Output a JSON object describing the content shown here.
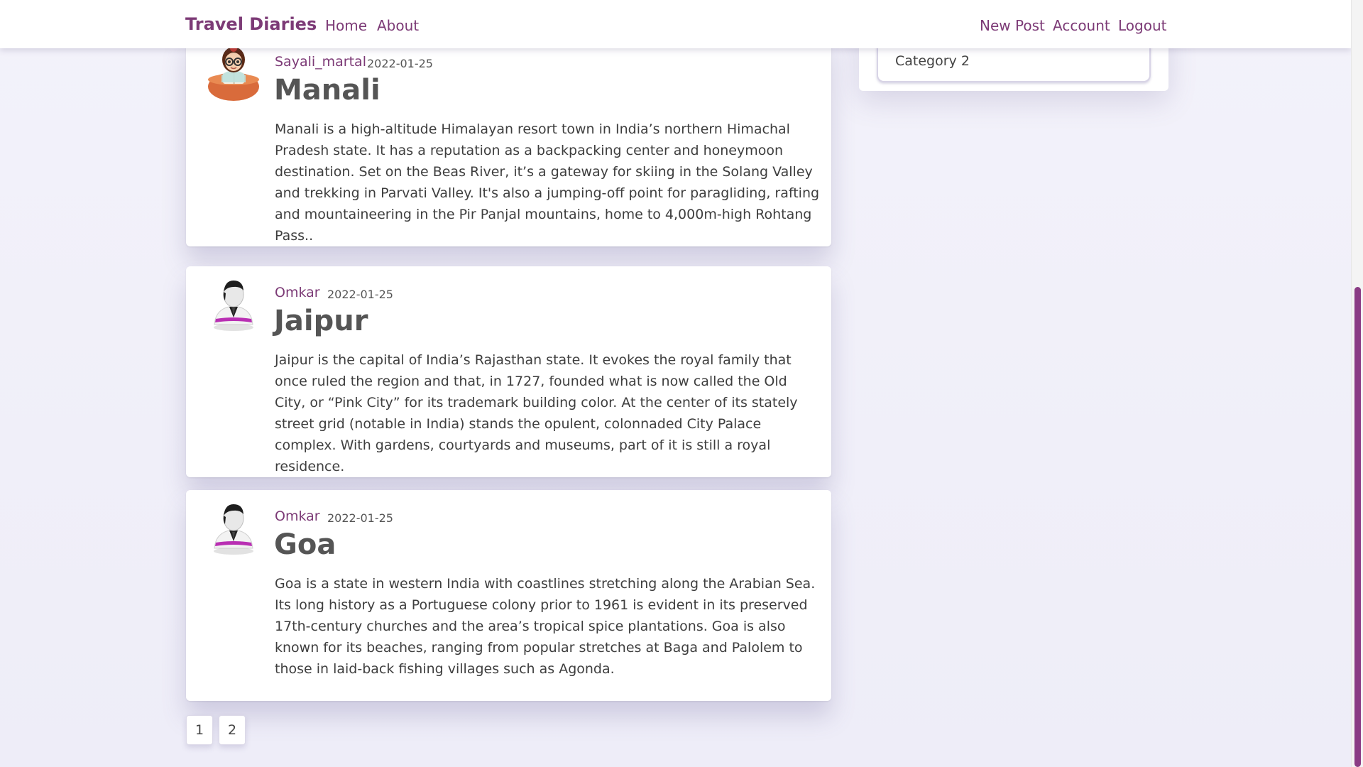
{
  "navbar": {
    "brand": "Travel Diaries",
    "links": {
      "home": "Home",
      "about": "About",
      "new_post": "New Post",
      "account": "Account",
      "logout": "Logout"
    }
  },
  "sidebar": {
    "items": [
      {
        "label": "Category 2"
      }
    ]
  },
  "posts": [
    {
      "author": "Sayali_martal",
      "date": "2022-01-25",
      "title": "Manali",
      "avatar_icon": "woman-reading-avatar-icon",
      "content": "Manali is a high-altitude Himalayan resort town in India’s northern Himachal Pradesh state. It has a reputation as a backpacking center and honeymoon destination. Set on the Beas River, it’s a gateway for skiing in the Solang Valley and trekking in Parvati Valley. It's also a jumping-off point for paragliding, rafting and mountaineering in the Pir Panjal mountains, home to 4,000m-high Rohtang Pass.."
    },
    {
      "author": "Omkar",
      "date": "2022-01-25",
      "title": "Jaipur",
      "avatar_icon": "user-silhouette-avatar-icon",
      "content": "Jaipur is the capital of India’s Rajasthan state. It evokes the royal family that once ruled the region and that, in 1727, founded what is now called the Old City, or “Pink City” for its trademark building color. At the center of its stately street grid (notable in India) stands the opulent, colonnaded City Palace complex. With gardens, courtyards and museums, part of it is still a royal residence."
    },
    {
      "author": "Omkar",
      "date": "2022-01-25",
      "title": "Goa",
      "avatar_icon": "user-silhouette-avatar-icon",
      "content": "Goa is a state in western India with coastlines stretching along the Arabian Sea. Its long history as a Portuguese colony prior to 1961 is evident in its preserved 17th-century churches and the area’s tropical spice plantations. Goa is also known for its beaches, ranging from popular stretches at Baga and Palolem to those in laid-back fishing villages such as Agonda."
    }
  ],
  "pagination": {
    "pages": [
      "1",
      "2"
    ]
  },
  "colors": {
    "accent": "#7c3a76",
    "scrollbar_thumb": "#8a3b84",
    "background": "#f1f0f9"
  }
}
